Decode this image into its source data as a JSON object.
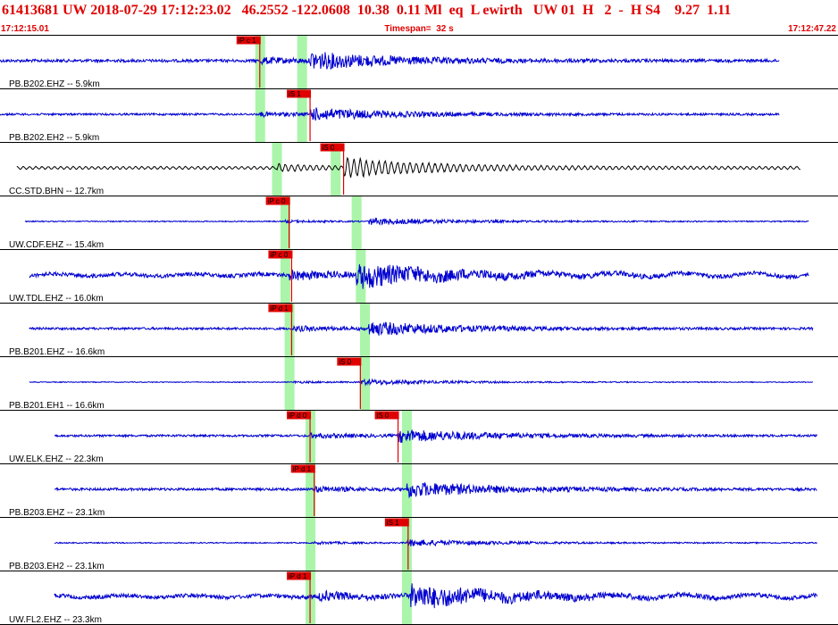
{
  "header": {
    "event_line": "61413681 UW 2018-07-29 17:12:23.02   46.2552 -122.0608  10.38  0.11 Ml  eq  L ewirth   UW 01  H   2  -  H S4    9.27  1.11"
  },
  "timebar": {
    "start_time": "17:12:15.01",
    "timespan_label": "Timespan=  32 s",
    "end_time": "17:12:47.22"
  },
  "colors": {
    "trace_blue": "#0000d0",
    "trace_black": "#000000",
    "window_green": "#aaf5aa",
    "pick_red": "#e00000",
    "header_red": "#e00000"
  },
  "panels": [
    {
      "label": "PB.B202.EHZ -- 5.9km",
      "color": "blue",
      "start": 0.0,
      "end": 0.93,
      "amp": 0.4,
      "arrival_p": 0.31,
      "arrival_s": 0.37,
      "green": [
        0.31,
        0.36
      ],
      "picks": [
        {
          "label": "iP c 1",
          "pos": 0.31
        }
      ]
    },
    {
      "label": "PB.B202.EH2 -- 5.9km",
      "color": "blue",
      "start": 0.0,
      "end": 0.93,
      "amp": 0.28,
      "arrival_p": 0.31,
      "arrival_s": 0.37,
      "green": [
        0.31,
        0.36
      ],
      "picks": [
        {
          "label": "iS 1",
          "pos": 0.37
        }
      ]
    },
    {
      "label": "CC.STD.BHN -- 12.7km",
      "color": "black",
      "start": 0.02,
      "end": 0.955,
      "amp": 0.45,
      "arrival_p": 0.33,
      "arrival_s": 0.41,
      "green": [
        0.33,
        0.4
      ],
      "picks": [
        {
          "label": "iS 0",
          "pos": 0.41
        }
      ]
    },
    {
      "label": "UW.CDF.EHZ -- 15.4km",
      "color": "blue",
      "start": 0.03,
      "end": 0.965,
      "amp": 0.15,
      "arrival_p": 0.34,
      "arrival_s": 0.44,
      "green": [
        0.34,
        0.425
      ],
      "picks": [
        {
          "label": "iP c 0",
          "pos": 0.345
        }
      ]
    },
    {
      "label": "UW.TDL.EHZ -- 16.0km",
      "color": "blue",
      "start": 0.035,
      "end": 0.965,
      "amp": 0.55,
      "arrival_p": 0.345,
      "arrival_s": 0.425,
      "green": [
        0.34,
        0.43
      ],
      "picks": [
        {
          "label": "iP c 0",
          "pos": 0.348
        }
      ]
    },
    {
      "label": "PB.B201.EHZ -- 16.6km",
      "color": "blue",
      "start": 0.035,
      "end": 0.97,
      "amp": 0.32,
      "arrival_p": 0.35,
      "arrival_s": 0.44,
      "green": [
        0.345,
        0.435
      ],
      "picks": [
        {
          "label": "iP d 1",
          "pos": 0.348
        }
      ]
    },
    {
      "label": "PB.B201.EH1 -- 16.6km",
      "color": "blue",
      "start": 0.035,
      "end": 0.97,
      "amp": 0.12,
      "arrival_p": 0.35,
      "arrival_s": 0.43,
      "green": [
        0.345,
        0.435
      ],
      "picks": [
        {
          "label": "iS 0",
          "pos": 0.43
        }
      ]
    },
    {
      "label": "UW.ELK.EHZ -- 22.3km",
      "color": "blue",
      "start": 0.065,
      "end": 0.975,
      "amp": 0.3,
      "arrival_p": 0.37,
      "arrival_s": 0.475,
      "green": [
        0.37,
        0.485
      ],
      "picks": [
        {
          "label": "iP d 0",
          "pos": 0.37
        },
        {
          "label": "iS 0",
          "pos": 0.475
        }
      ]
    },
    {
      "label": "PB.B203.EHZ -- 23.1km",
      "color": "blue",
      "start": 0.065,
      "end": 0.975,
      "amp": 0.35,
      "arrival_p": 0.375,
      "arrival_s": 0.485,
      "green": [
        0.37,
        0.485
      ],
      "picks": [
        {
          "label": "iP d 1",
          "pos": 0.375
        }
      ]
    },
    {
      "label": "PB.B203.EH2 -- 23.1km",
      "color": "blue",
      "start": 0.065,
      "end": 0.975,
      "amp": 0.15,
      "arrival_p": 0.375,
      "arrival_s": 0.485,
      "green": [
        0.37,
        0.485
      ],
      "picks": [
        {
          "label": "iS 1",
          "pos": 0.487
        }
      ]
    },
    {
      "label": "UW.FL2.EHZ -- 23.3km",
      "color": "blue",
      "start": 0.065,
      "end": 0.975,
      "amp": 0.55,
      "arrival_p": 0.38,
      "arrival_s": 0.49,
      "green": [
        0.37,
        0.485
      ],
      "picks": [
        {
          "label": "iP d 1",
          "pos": 0.37
        }
      ]
    }
  ]
}
